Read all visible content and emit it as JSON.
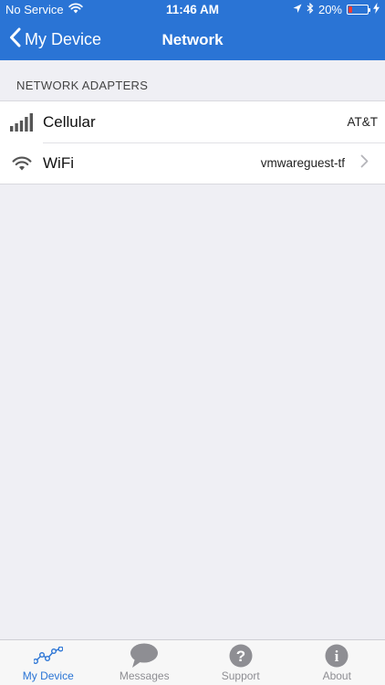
{
  "status_bar": {
    "carrier": "No Service",
    "time": "11:46 AM",
    "battery_percent": "20%",
    "battery_level": 0.2,
    "battery_color": "#ff3b30"
  },
  "nav": {
    "back_label": "My Device",
    "title": "Network",
    "bar_color": "#2a74d5"
  },
  "section": {
    "header": "NETWORK ADAPTERS"
  },
  "adapters": [
    {
      "label": "Cellular",
      "value": "AT&T",
      "icon": "cellular-signal-icon",
      "has_chevron": false
    },
    {
      "label": "WiFi",
      "value": "vmwareguest-tf",
      "icon": "wifi-icon",
      "has_chevron": true
    }
  ],
  "tabs": [
    {
      "label": "My Device",
      "icon": "device-activity-icon",
      "active": true
    },
    {
      "label": "Messages",
      "icon": "chat-bubble-icon",
      "active": false
    },
    {
      "label": "Support",
      "icon": "question-circle-icon",
      "active": false
    },
    {
      "label": "About",
      "icon": "info-circle-icon",
      "active": false
    }
  ],
  "colors": {
    "accent": "#2a74d5",
    "inactive_tab": "#8e8e93",
    "background": "#efeff4"
  }
}
